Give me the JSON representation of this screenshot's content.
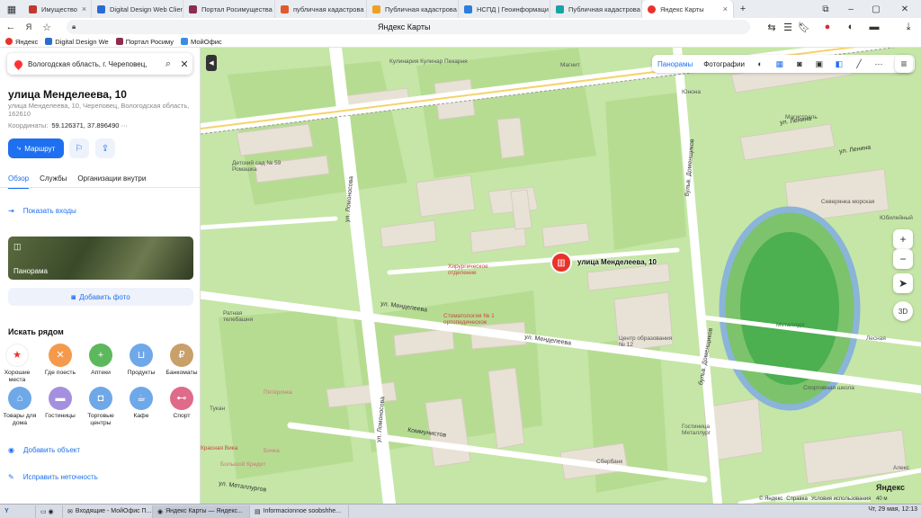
{
  "browser": {
    "tabs": [
      {
        "label": "Имущество",
        "color": "#c0392b"
      },
      {
        "label": "Digital Design Web Clien",
        "color": "#2b6cd0"
      },
      {
        "label": "Портал Росимущества",
        "color": "#8e2c4e"
      },
      {
        "label": "публичная кадастрова",
        "color": "#e05a2b"
      },
      {
        "label": "Публичная кадастрова",
        "color": "#f0a020"
      },
      {
        "label": "НСПД | Геоинформаци",
        "color": "#2b7de0"
      },
      {
        "label": "Публичная кадастрова",
        "color": "#1aa3a3"
      },
      {
        "label": "Яндекс Карты",
        "color": "#e8332b"
      }
    ],
    "page_title": "Яндекс Карты",
    "bookmarks": [
      {
        "label": "Яндекс",
        "color": "#e8332b"
      },
      {
        "label": "Digital Design We",
        "color": "#2b6cd0"
      },
      {
        "label": "Портал Росиму",
        "color": "#8e2c4e"
      },
      {
        "label": "МойОфис",
        "color": "#3a8de0"
      }
    ]
  },
  "sidebar": {
    "search_value": "Вологодская область, г. Череповец,",
    "title": "улица Менделеева, 10",
    "address": "улица Менделеева, 10, Череповец, Вологодская область, 162610",
    "coords_label": "Координаты:",
    "coords_value": "59.126371, 37.896490",
    "route_label": "Маршрут",
    "tabs": [
      "Обзор",
      "Службы",
      "Организации внутри"
    ],
    "entrances_label": "Показать входы",
    "panorama_label": "Панорама",
    "add_photo_label": "Добавить фото",
    "nearby_title": "Искать рядом",
    "categories": [
      {
        "label": "Хорошие места",
        "color": "#ffffff",
        "icon": "★"
      },
      {
        "label": "Где поесть",
        "color": "#f59a4c",
        "icon": "🍴"
      },
      {
        "label": "Аптеки",
        "color": "#5cb85c",
        "icon": "+"
      },
      {
        "label": "Продукты",
        "color": "#6fa8e8",
        "icon": "🛒"
      },
      {
        "label": "Банкоматы",
        "color": "#c9a06a",
        "icon": "₽"
      },
      {
        "label": "Товары для дома",
        "color": "#6fa8e8",
        "icon": "🏠"
      },
      {
        "label": "Гостиницы",
        "color": "#a58fe0",
        "icon": "🛏"
      },
      {
        "label": "Торговые центры",
        "color": "#6fa8e8",
        "icon": "🛍"
      },
      {
        "label": "Кафе",
        "color": "#6fa8e8",
        "icon": "☕"
      },
      {
        "label": "Спорт",
        "color": "#e06a8a",
        "icon": "🏋"
      }
    ],
    "add_object_label": "Добавить объект",
    "fix_error_label": "Исправить неточность"
  },
  "map": {
    "toolbar": {
      "panoramas": "Панорамы",
      "photos": "Фотографии"
    },
    "marker_label": "улица Менделеева, 10",
    "streets": [
      "ул. Ленина",
      "ул. Ленина",
      "ул. Ломоносова",
      "ул. Ломоносова",
      "бульв. Доменщиков",
      "бульв. Доменщиков",
      "ул. Менделеева",
      "ул. Менделеева",
      "Коммунистов",
      "ул. Металлургов"
    ],
    "labels": [
      "Кулинария Кулинар Пекарня",
      "Магнит",
      "Юнона",
      "Магистраль",
      "Детский сад № 59 Ромашка",
      "Хирургическое отделение",
      "Стоматология № 1 ортопедическое",
      "Центр образования № 12",
      "Металлург",
      "Сбербанк",
      "Бочка",
      "Пятёрочка",
      "Гостиница Металлург",
      "Лесная",
      "Северянка морская",
      "Юбилейный",
      "Ратная телебашня",
      "Тукан",
      "Красная Вика",
      "Большой Кредит",
      "Спортивная школа",
      "Алекс"
    ],
    "logo": "Яндекс",
    "copyright": [
      "© Яндекс",
      "Справка",
      "Условия использования"
    ],
    "scale": "40 м",
    "controls": {
      "zoom_in": "+",
      "zoom_out": "−",
      "compass": "➤",
      "three_d": "3D"
    }
  },
  "taskbar": {
    "items": [
      "Входящие - МойОфис П...",
      "Яндекс Карты — Яндекс...",
      "Informacionnoe soobshhe..."
    ],
    "clock": "Чт, 29 мая, 12:13"
  }
}
